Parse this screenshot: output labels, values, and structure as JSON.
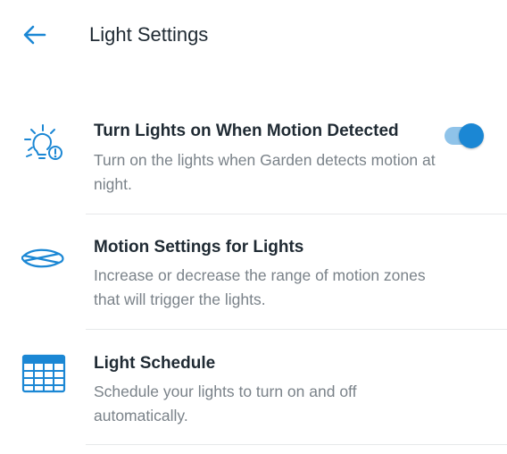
{
  "header": {
    "title": "Light Settings",
    "back_icon": "arrow-left-icon"
  },
  "colors": {
    "accent": "#1b87d4",
    "toggle_track": "#8fc3e9",
    "title_text": "#1f2a33",
    "secondary_text": "#7a8289",
    "divider": "#e6e8ea"
  },
  "settings": [
    {
      "icon": "lightbulb-motion-icon",
      "title": "Turn Lights on When Motion Detected",
      "description": "Turn on the lights when Garden detects motion at night.",
      "toggle_on": true
    },
    {
      "icon": "motion-zone-icon",
      "title": "Motion Settings for Lights",
      "description": "Increase or decrease the range of motion zones that will trigger the lights."
    },
    {
      "icon": "calendar-icon",
      "title": "Light Schedule",
      "description": "Schedule your lights to turn on and off automatically."
    }
  ]
}
